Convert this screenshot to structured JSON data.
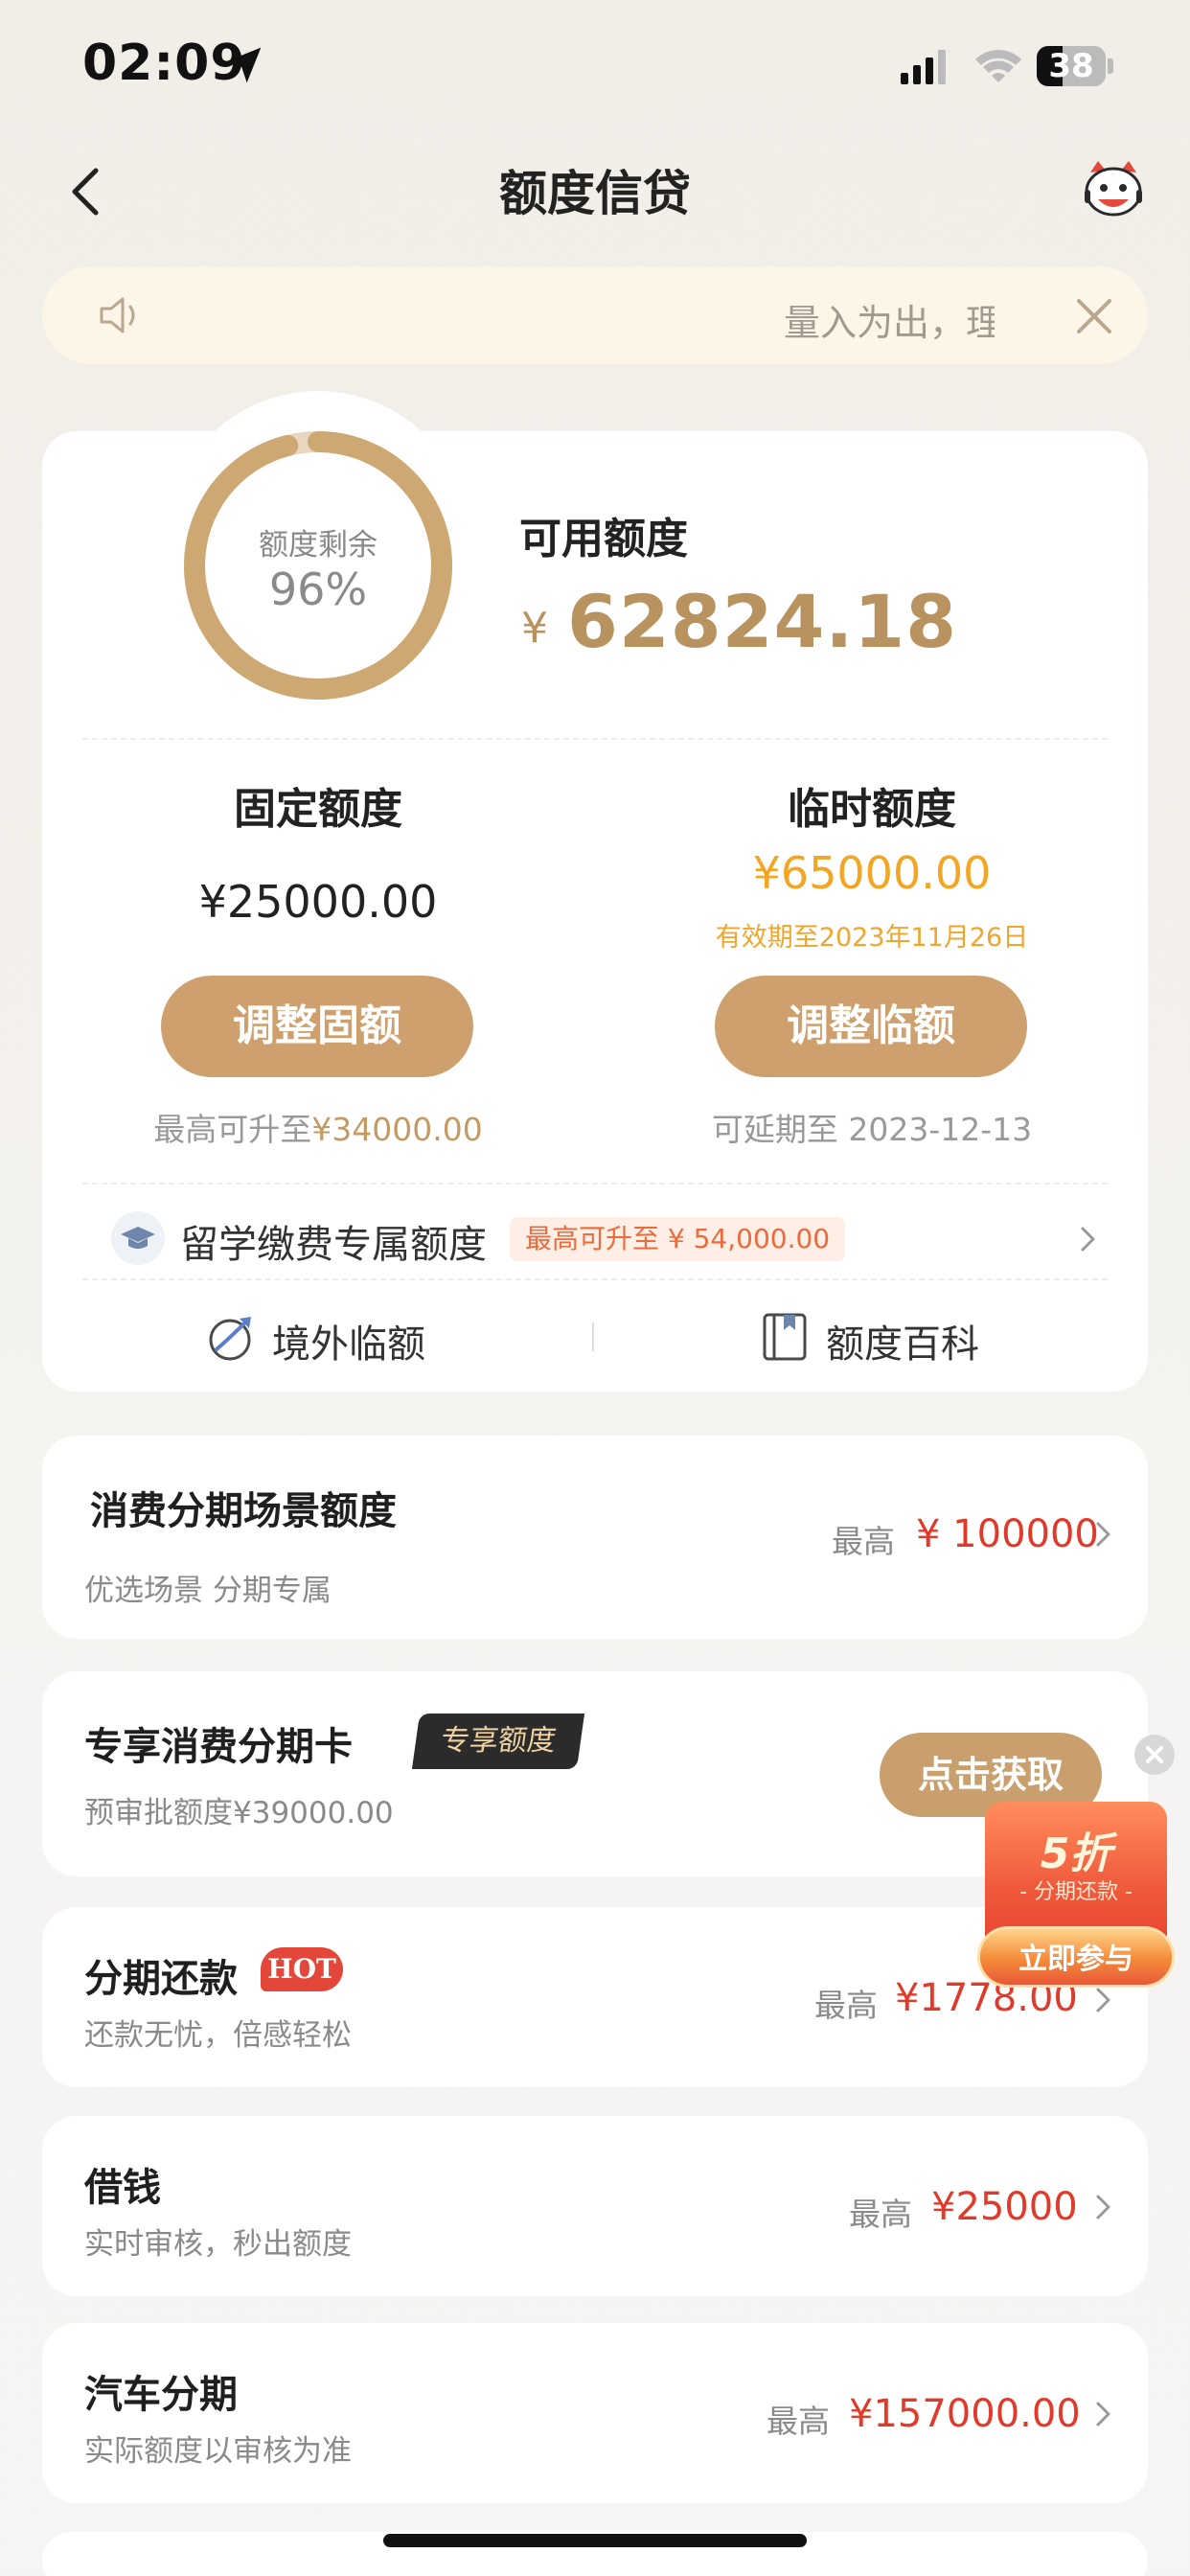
{
  "status_bar": {
    "time": "02:09",
    "battery": "38",
    "battery_level": 0.38
  },
  "nav": {
    "title": "额度信贷"
  },
  "notice": {
    "text": "量入为出，理性消费"
  },
  "credit": {
    "ring_label": "额度剩余",
    "ring_percent": "96%",
    "ring_fraction": 0.96,
    "available_label": "可用额度",
    "available_currency": "¥",
    "available_amount": "62824.18",
    "fixed": {
      "title": "固定额度",
      "amount": "¥25000.00",
      "button": "调整固额",
      "max_prefix": "最高可升至",
      "max_amount": "¥34000.00"
    },
    "temporary": {
      "title": "临时额度",
      "amount": "¥65000.00",
      "valid_until": "有效期至2023年11月26日",
      "button": "调整临额",
      "extend": "可延期至 2023-12-13"
    },
    "study": {
      "label": "留学缴费专属额度",
      "badge": "最高可升至 ¥ 54,000.00"
    },
    "links": {
      "overseas": "境外临额",
      "wiki": "额度百科"
    }
  },
  "products": {
    "scene": {
      "title": "消费分期场景额度",
      "subtitle": "优选场景 分期专属",
      "max_label": "最高",
      "amount": "¥ 100000"
    },
    "card": {
      "title": "专享消费分期卡",
      "badge": "专享额度",
      "subtitle": "预审批额度¥39000.00",
      "button": "点击获取"
    },
    "installment": {
      "title": "分期还款",
      "badge": "HOT",
      "subtitle": "还款无忧，倍感轻松",
      "max_label": "最高",
      "amount": "¥1778.00"
    },
    "loan": {
      "title": "借钱",
      "subtitle": "实时审核，秒出额度",
      "max_label": "最高",
      "amount": "¥25000"
    },
    "car": {
      "title": "汽车分期",
      "subtitle": "实际额度以审核为准",
      "max_label": "最高",
      "amount": "¥157000.00"
    }
  },
  "promo": {
    "discount": "5折",
    "caption": "- 分期还款 -",
    "button": "立即参与"
  },
  "colors": {
    "gold": "#b8935f",
    "button_gold": "#cda06d",
    "orange": "#f3a623",
    "red": "#e03a2b",
    "badge_red": "#e2473a"
  },
  "icons": [
    "location-arrow-icon",
    "signal-icon",
    "wifi-icon",
    "battery-icon",
    "back-chevron-icon",
    "mascot-avatar-icon",
    "speaker-icon",
    "close-icon",
    "graduation-cap-icon",
    "globe-plane-icon",
    "book-icon",
    "chevron-right-icon"
  ]
}
